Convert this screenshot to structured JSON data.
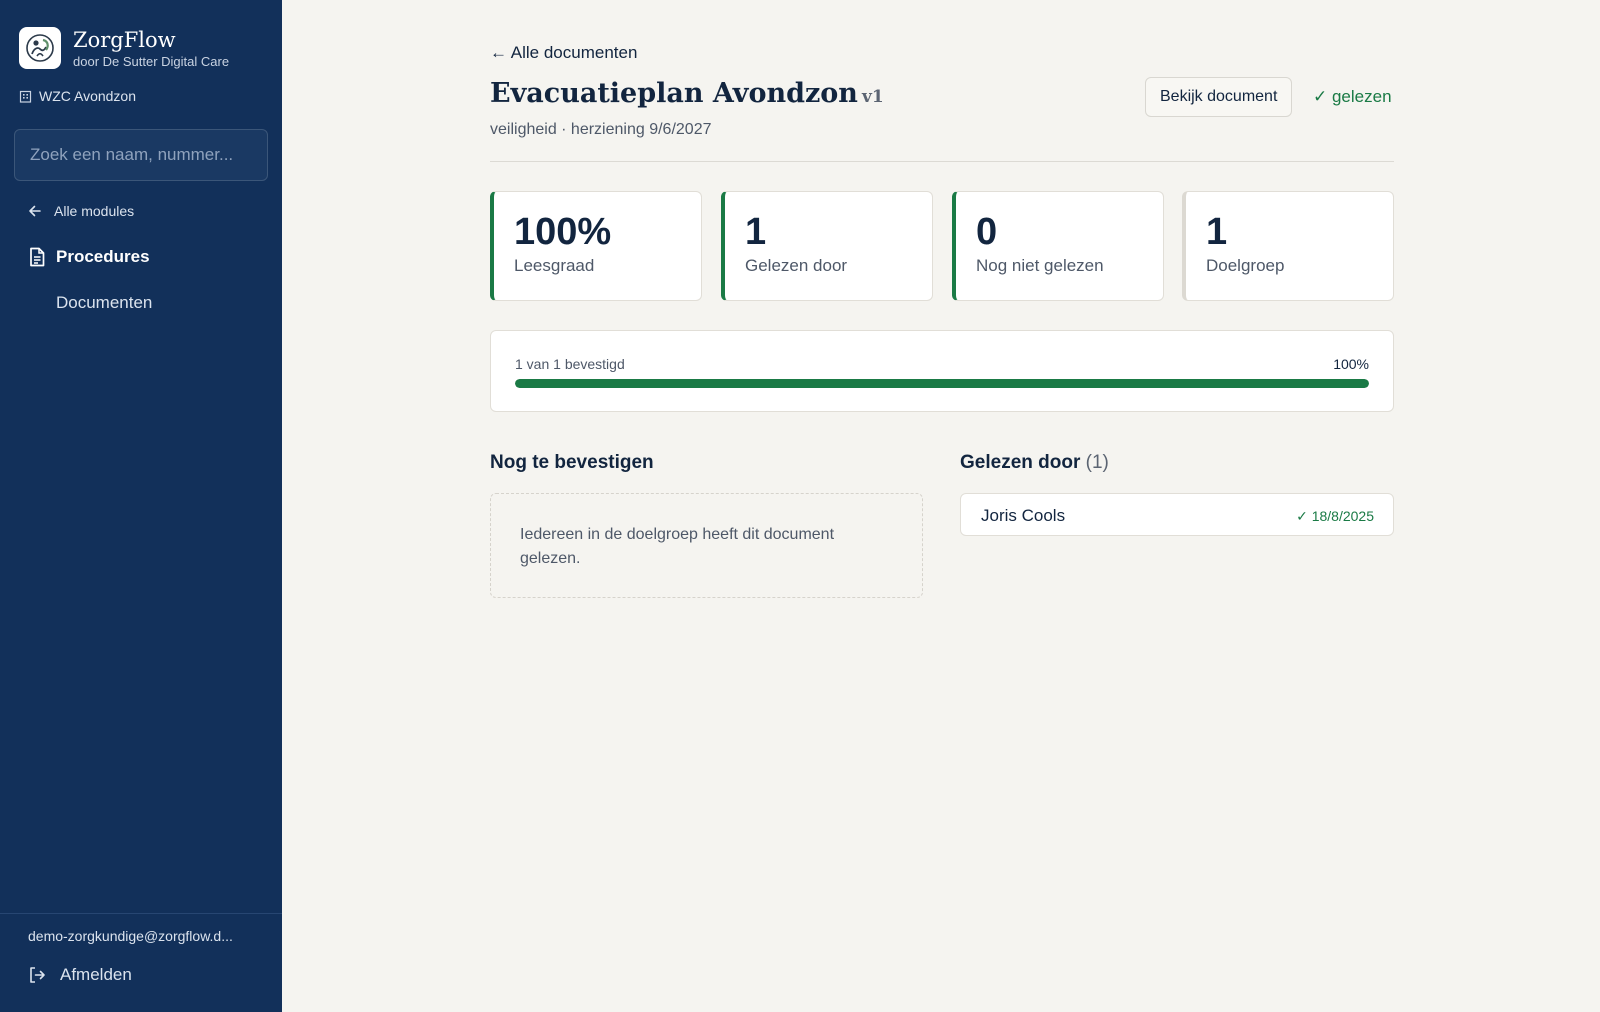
{
  "sidebar": {
    "brand_name": "ZorgFlow",
    "brand_sub": "door De Sutter Digital Care",
    "org_name": "WZC Avondzon",
    "search_placeholder": "Zoek een naam, nummer...",
    "back_label": "Alle modules",
    "module_label": "Procedures",
    "sub_item_label": "Documenten",
    "user_email": "demo-zorgkundige@zorgflow.d...",
    "logout_label": "Afmelden"
  },
  "header": {
    "back_link": "← Alle documenten",
    "title": "Evacuatieplan Avondzon",
    "version": "v1",
    "subtitle": "veiligheid · herziening 9/6/2027",
    "view_button": "Bekijk document",
    "read_status": "✓ gelezen"
  },
  "stats": [
    {
      "value": "100%",
      "label": "Leesgraad"
    },
    {
      "value": "1",
      "label": "Gelezen door"
    },
    {
      "value": "0",
      "label": "Nog niet gelezen"
    },
    {
      "value": "1",
      "label": "Doelgroep"
    }
  ],
  "progress": {
    "text": "1 van 1 bevestigd",
    "percent_label": "100%",
    "fraction": 1.0
  },
  "pending": {
    "title": "Nog te bevestigen",
    "empty_text": "Iedereen in de doelgroep heeft dit document gelezen."
  },
  "readers": {
    "title": "Gelezen door",
    "count": "(1)",
    "items": [
      {
        "name": "Joris Cools",
        "date": "✓ 18/8/2025"
      }
    ]
  },
  "colors": {
    "sidebar_bg": "#12305a",
    "accent_green": "#1a7a45",
    "page_bg": "#f5f4f0"
  },
  "icons": [
    "zorgflow-logo",
    "building-icon",
    "arrow-left-icon",
    "document-icon",
    "logout-icon"
  ]
}
